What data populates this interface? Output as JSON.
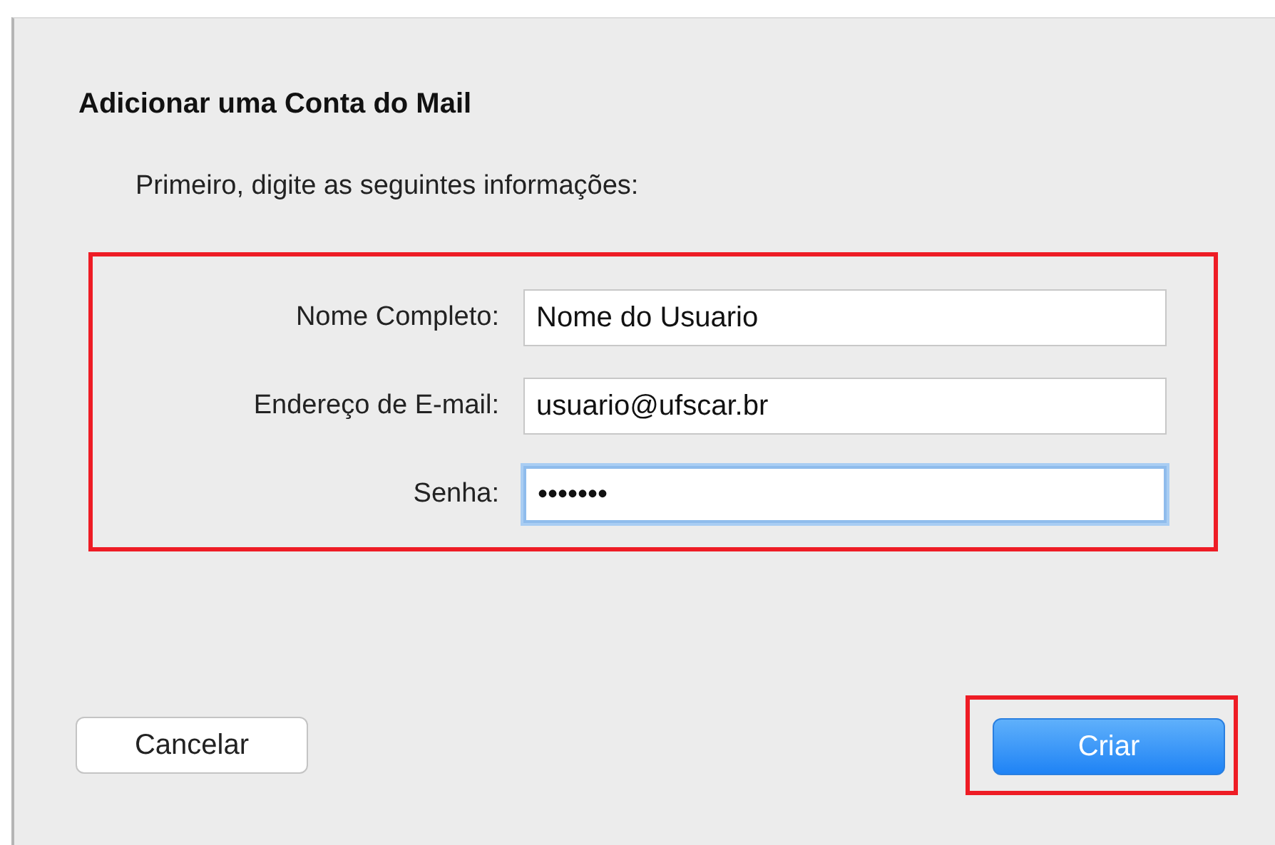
{
  "dialog": {
    "title": "Adicionar uma Conta do Mail",
    "subtitle": "Primeiro, digite as seguintes informações:"
  },
  "form": {
    "highlighted": true,
    "fields": [
      {
        "label": "Nome Completo:",
        "value": "Nome do Usuario",
        "focused": false
      },
      {
        "label": "Endereço de E-mail:",
        "value": "usuario@ufscar.br",
        "focused": false
      },
      {
        "label": "Senha:",
        "value": "•••••••",
        "focused": true
      }
    ]
  },
  "buttons": [
    {
      "label": "Cancelar",
      "kind": "normal",
      "highlighted": false
    },
    {
      "label": "Criar",
      "kind": "default",
      "highlighted": true
    }
  ]
}
